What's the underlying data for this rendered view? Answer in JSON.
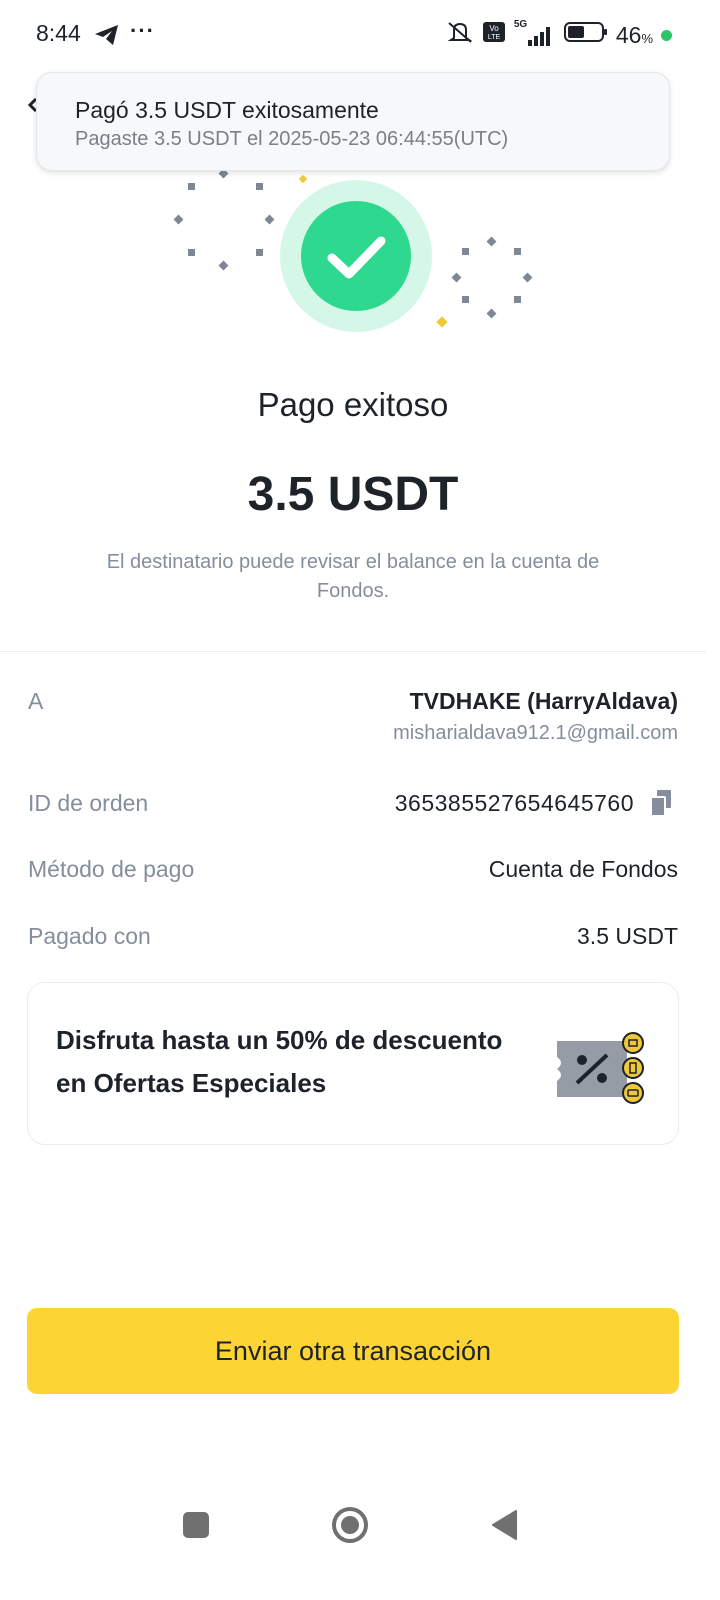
{
  "status_bar": {
    "time": "8:44",
    "ellipsis": "···",
    "network": "5G",
    "battery_percent": "46",
    "percent_sign": "%"
  },
  "toast": {
    "title": "Pagó 3.5 USDT exitosamente",
    "subtitle": "Pagaste 3.5 USDT el 2025-05-23 06:44:55(UTC)"
  },
  "result": {
    "title": "Pago exitoso",
    "amount": "3.5 USDT",
    "description": "El destinatario puede revisar el balance en la cuenta de Fondos."
  },
  "details": {
    "recipient_label": "A",
    "recipient_name": "TVDHAKE (HarryAldava)",
    "recipient_email": "misharialdava912.1@gmail.com",
    "order_label": "ID de orden",
    "order_id": "365385527654645760",
    "method_label": "Método de pago",
    "method_value": "Cuenta de Fondos",
    "paid_with_label": "Pagado con",
    "paid_with_value": "3.5 USDT"
  },
  "promo": {
    "text": "Disfruta hasta un 50% de descuento en Ofertas Especiales",
    "icon": "discount-ticket-icon"
  },
  "cta": {
    "label": "Enviar otra transacción"
  },
  "colors": {
    "accent": "#fcd535",
    "success": "#2ed88f",
    "success_halo": "#d4f7e7",
    "muted_text": "#848e9c"
  }
}
